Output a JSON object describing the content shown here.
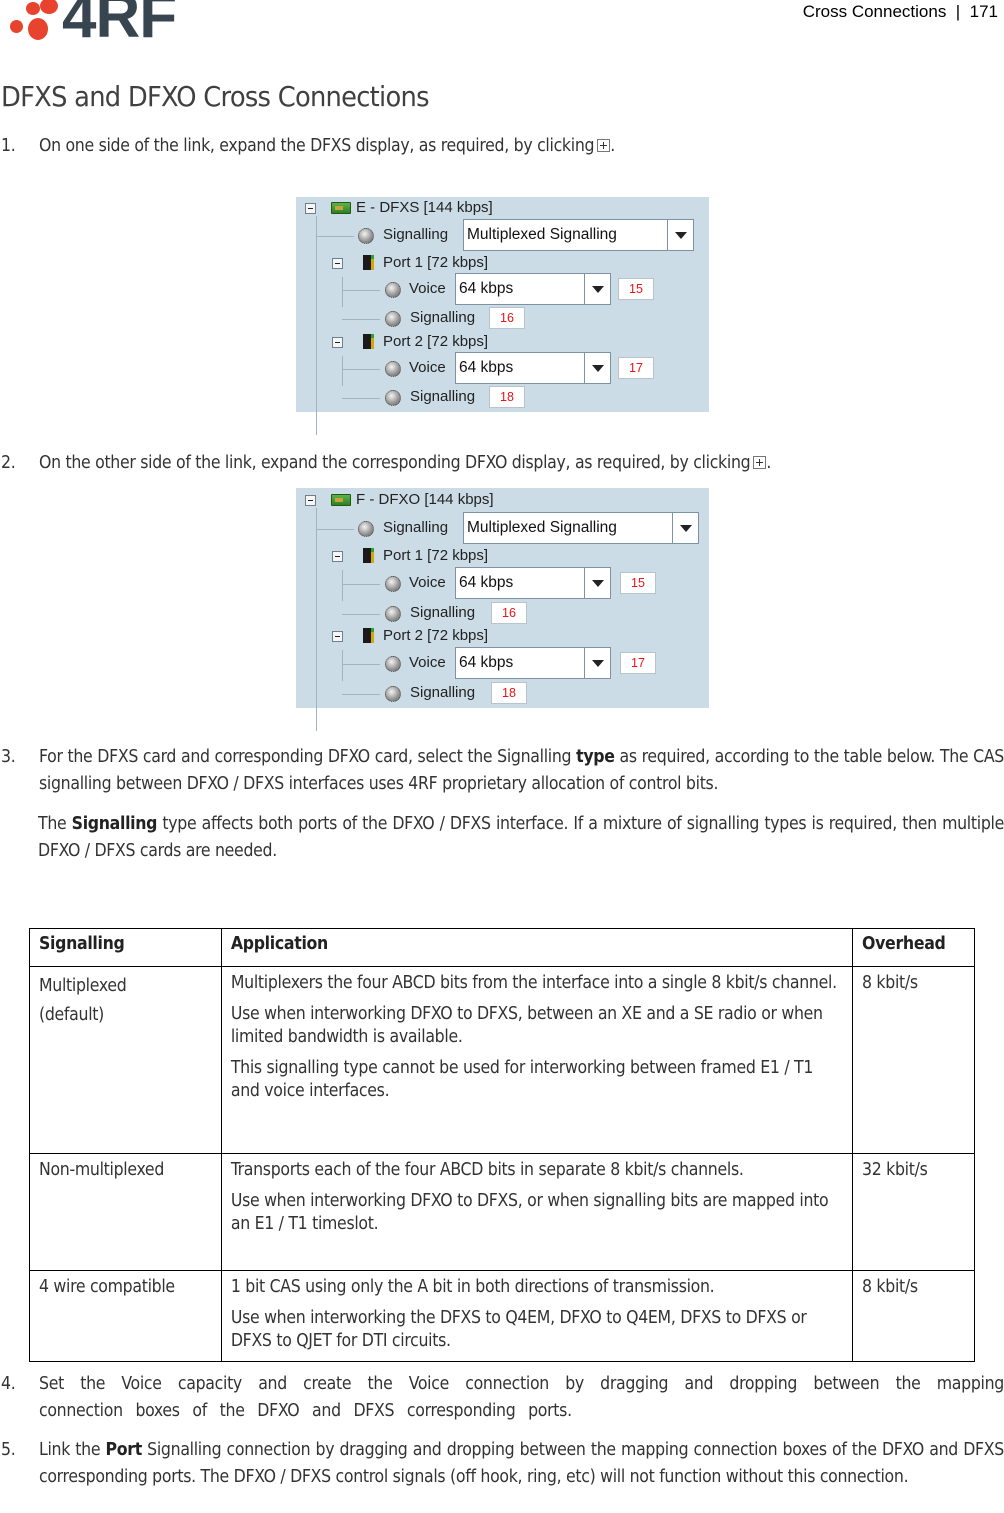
{
  "header": {
    "logo_text": "4RF",
    "running_head": "Cross Connections  |  171"
  },
  "page_title": "DFXS and DFXO Cross Connections",
  "steps": {
    "s1": {
      "num": "1.",
      "text": "On one side of the link, expand the DFXS display, as required, by clicking",
      "end": "."
    },
    "s2": {
      "num": "2.",
      "text": "On the other side of the link, expand the corresponding DFXO display, as required, by clicking",
      "end": "."
    },
    "s3": {
      "num": "3.",
      "text_a": "For the DFXS card and corresponding DFXO card, select the Signalling ",
      "bold": "type",
      "text_b": " as required, according to the table below. The CAS signalling between DFXO / DFXS interfaces uses 4RF proprietary allocation of control bits.",
      "note_a": "The ",
      "note_bold": "Signalling",
      "note_b": " type affects both ports of the DFXO / DFXS interface. If a mixture of signalling types is required, then multiple DFXO / DFXS cards are needed."
    },
    "s4": {
      "num": "4.",
      "text": "Set the Voice capacity and create the Voice connection by dragging and dropping between the mapping connection boxes of the DFXO and DFXS corresponding ports."
    },
    "s5": {
      "num": "5.",
      "text_a": "Link the ",
      "bold": "Port",
      "text_b": " Signalling connection by dragging and dropping between the mapping connection boxes of the DFXO and DFXS corresponding ports. The DFXO / DFXS control signals (off hook, ring, etc) will not function without this connection."
    }
  },
  "trees": [
    {
      "card_label": "E - DFXS [144 kbps]",
      "signalling_label": "Signalling",
      "signalling_value": "Multiplexed Signalling",
      "ports": [
        {
          "label": "Port 1 [72 kbps]",
          "voice_label": "Voice",
          "voice_value": "64 kbps",
          "voice_slot": "15",
          "sig_label": "Signalling",
          "sig_slot": "16"
        },
        {
          "label": "Port 2 [72 kbps]",
          "voice_label": "Voice",
          "voice_value": "64 kbps",
          "voice_slot": "17",
          "sig_label": "Signalling",
          "sig_slot": "18"
        }
      ]
    },
    {
      "card_label": "F - DFXO [144 kbps]",
      "signalling_label": "Signalling",
      "signalling_value": "Multiplexed Signalling",
      "ports": [
        {
          "label": "Port 1 [72 kbps]",
          "voice_label": "Voice",
          "voice_value": "64 kbps",
          "voice_slot": "15",
          "sig_label": "Signalling",
          "sig_slot": "16"
        },
        {
          "label": "Port 2 [72 kbps]",
          "voice_label": "Voice",
          "voice_value": "64 kbps",
          "voice_slot": "17",
          "sig_label": "Signalling",
          "sig_slot": "18"
        }
      ]
    }
  ],
  "table": {
    "headers": [
      "Signalling",
      "Application",
      "Overhead"
    ],
    "rows": [
      {
        "signalling": [
          "Multiplexed",
          "(default)"
        ],
        "application": [
          "Multiplexers the four ABCD bits from the interface into a single 8 kbit/s channel.",
          "Use when interworking DFXO to DFXS, between an XE and a SE radio or when limited bandwidth is available.",
          "This signalling type cannot be used for interworking between framed E1 / T1 and voice interfaces."
        ],
        "overhead": "8 kbit/s"
      },
      {
        "signalling": [
          "Non-multiplexed"
        ],
        "application": [
          "Transports each of the four ABCD bits in separate 8 kbit/s channels.",
          "Use when interworking DFXO to DFXS, or when signalling bits are mapped into an E1 / T1 timeslot."
        ],
        "overhead": "32 kbit/s"
      },
      {
        "signalling": [
          "4 wire compatible"
        ],
        "application": [
          "1 bit CAS using only the A bit in both directions of transmission.",
          "Use when interworking the DFXS to Q4EM, DFXO to Q4EM, DFXS to DFXS or DFXS to QJET for DTI circuits."
        ],
        "overhead": "8 kbit/s"
      }
    ]
  },
  "colors": {
    "logo_red": "#e8432e",
    "logo_gray": "#36454f",
    "tree_bg": "#ccdce6",
    "slot_text": "#e8141a"
  }
}
